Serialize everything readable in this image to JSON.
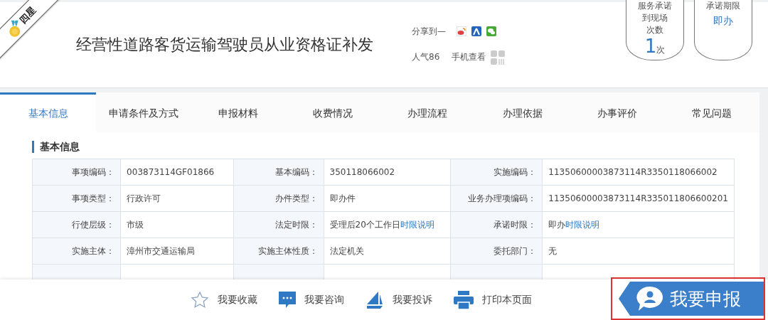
{
  "ribbon": {
    "text": "四星"
  },
  "title": "经营性道路客货运输驾驶员从业资格证补发",
  "share": {
    "label": "分享到—"
  },
  "popularity": "人气86",
  "mobile_view": "手机查看",
  "promises": [
    {
      "kind": "count",
      "lines": [
        "服务承诺",
        "到现场",
        "次数"
      ],
      "value": "1",
      "unit": "次"
    },
    {
      "kind": "term",
      "lines": [
        "承诺期限"
      ],
      "value": "即办"
    }
  ],
  "tabs": [
    {
      "label": "基本信息",
      "selected": true
    },
    {
      "label": "申请条件及方式",
      "selected": false
    },
    {
      "label": "申报材料",
      "selected": false
    },
    {
      "label": "收费情况",
      "selected": false
    },
    {
      "label": "办理流程",
      "selected": false
    },
    {
      "label": "办理依据",
      "selected": false
    },
    {
      "label": "办事评价",
      "selected": false
    },
    {
      "label": "常见问题",
      "selected": false
    }
  ],
  "section_title": "基本信息",
  "table": {
    "rows": [
      [
        {
          "label": "事项编码：",
          "value": "003873114GF01866"
        },
        {
          "label": "基本编码：",
          "value": "350118066002"
        },
        {
          "label": "实施编码：",
          "value": "11350600003873114R3350118066002"
        }
      ],
      [
        {
          "label": "事项类型：",
          "value": "行政许可"
        },
        {
          "label": "办件类型：",
          "value": "即办件"
        },
        {
          "label": "业务办理项编码：",
          "value": "11350600003873114R335011806600201"
        }
      ],
      [
        {
          "label": "行使层级：",
          "value": "市级"
        },
        {
          "label": "法定时限：",
          "value": "受理后20个工作日",
          "link": "时限说明"
        },
        {
          "label": "承诺时限：",
          "value": "即办",
          "link": "时限说明"
        }
      ],
      [
        {
          "label": "实施主体：",
          "value": "漳州市交通运输局"
        },
        {
          "label": "实施主体性质：",
          "value": "法定机关"
        },
        {
          "label": "委托部门：",
          "value": "无"
        }
      ]
    ]
  },
  "actions": [
    {
      "kind": "favorite",
      "label": "我要收藏"
    },
    {
      "kind": "consult",
      "label": "我要咨询"
    },
    {
      "kind": "complain",
      "label": "我要投诉"
    },
    {
      "kind": "print",
      "label": "打印本页面"
    }
  ],
  "apply_button": {
    "label": "我要申报"
  }
}
